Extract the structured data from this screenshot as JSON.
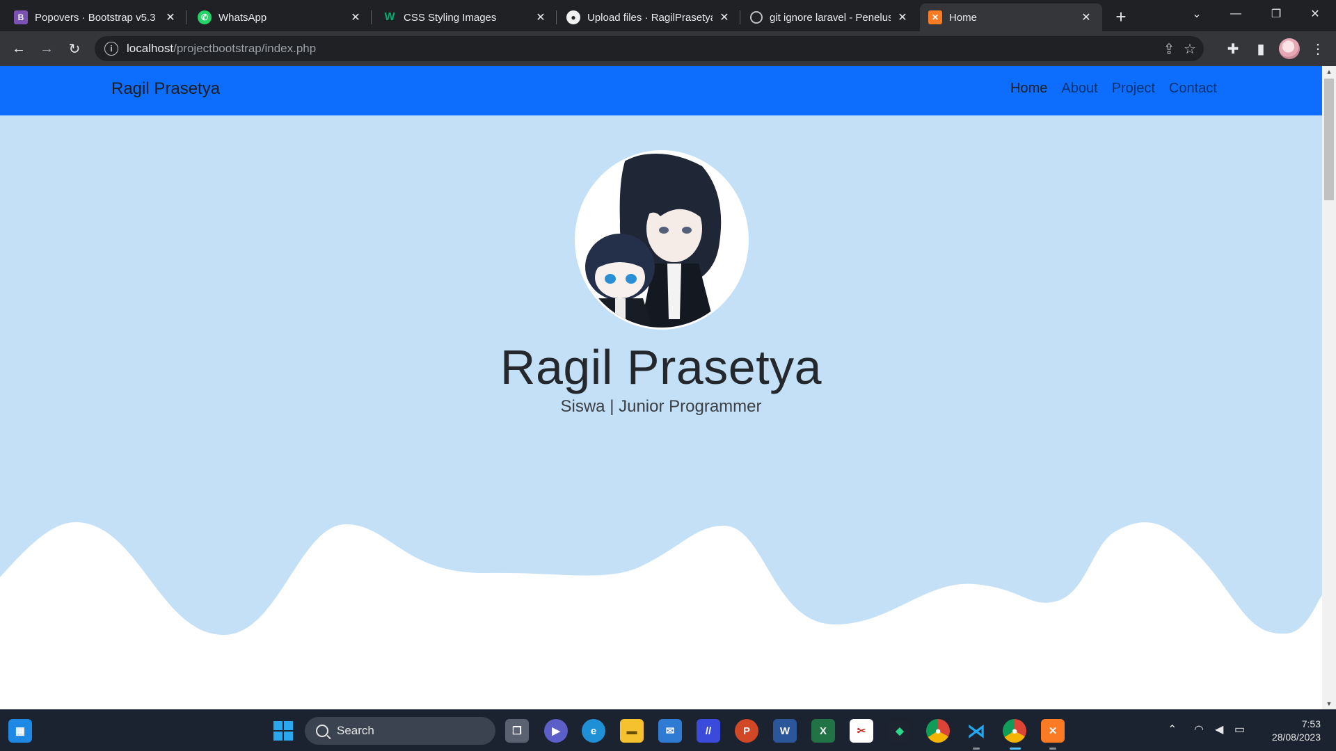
{
  "browser": {
    "tabs": [
      {
        "title": "Popovers · Bootstrap v5.3",
        "icon": "bootstrap-icon"
      },
      {
        "title": "WhatsApp",
        "icon": "whatsapp-icon"
      },
      {
        "title": "CSS Styling Images",
        "icon": "w3schools-icon"
      },
      {
        "title": "Upload files · RagilPrasetya/",
        "icon": "github-icon"
      },
      {
        "title": "git ignore laravel - Penelus",
        "icon": "globe-icon"
      },
      {
        "title": "Home",
        "icon": "xampp-icon"
      }
    ],
    "active_tab": 5,
    "url_host": "localhost",
    "url_path": "/projectbootstrap/index.php"
  },
  "site": {
    "brand": "Ragil Prasetya",
    "nav": [
      "Home",
      "About",
      "Project",
      "Contact"
    ],
    "active_nav": "Home",
    "hero": {
      "name": "Ragil Prasetya",
      "subtitle": "Siswa | Junior Programmer"
    }
  },
  "colors": {
    "navbar": "#0d6efd",
    "hero_bg": "#c3e0f6",
    "wave_fill": "#ffffff"
  },
  "taskbar": {
    "search_placeholder": "Search",
    "time": "7:53",
    "date": "28/08/2023",
    "pinned": [
      "task-view-icon",
      "meet-icon",
      "edge-icon",
      "file-explorer-icon",
      "mail-icon",
      "app-icon",
      "powerpoint-icon",
      "word-icon",
      "excel-icon",
      "snipping-icon",
      "app-icon",
      "chrome-icon",
      "vscode-icon",
      "chrome-icon",
      "xampp-icon"
    ]
  }
}
